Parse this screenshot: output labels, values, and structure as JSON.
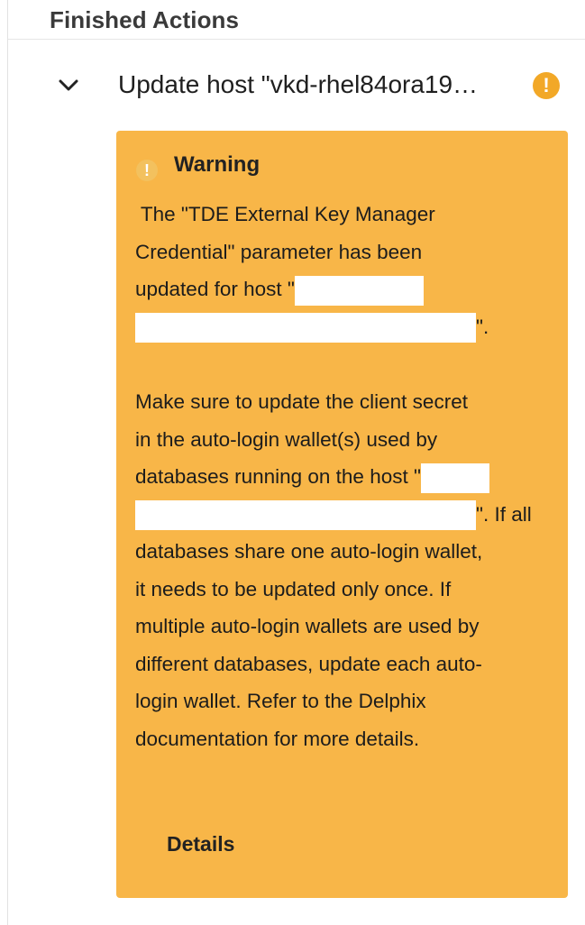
{
  "panel": {
    "title": "Finished Actions"
  },
  "action": {
    "title": "Update host \"vkd-rhel84ora19…",
    "status_icon": "warning-exclamation-icon",
    "expand_icon": "chevron-down-icon"
  },
  "warning": {
    "title": "Warning",
    "icon": "warning-exclamation-icon",
    "p1_line1": " The \"TDE External Key Manager",
    "p1_line2": "Credential\" parameter has been",
    "p1_line3_prefix": "updated for host \"",
    "p1_line4_suffix": "\".",
    "p2_line1": "Make sure to update the client secret",
    "p2_line2": "in the auto-login wallet(s) used by",
    "p2_line3_prefix": "databases running on the host \"",
    "p2_line4_suffix": "\". If all",
    "p2_line5": "databases share one auto-login wallet,",
    "p2_line6": "it needs to be updated only once. If",
    "p2_line7": "multiple auto-login wallets are used by",
    "p2_line8": "different databases, update each auto-",
    "p2_line9": "login wallet. Refer to the Delphix",
    "p2_line10": "documentation for more details.",
    "details_label": "Details"
  },
  "colors": {
    "warning_background": "#f8b648",
    "badge": "#f2a827",
    "panel_border": "#e2e2e2",
    "title_text": "#3a3a3a"
  }
}
